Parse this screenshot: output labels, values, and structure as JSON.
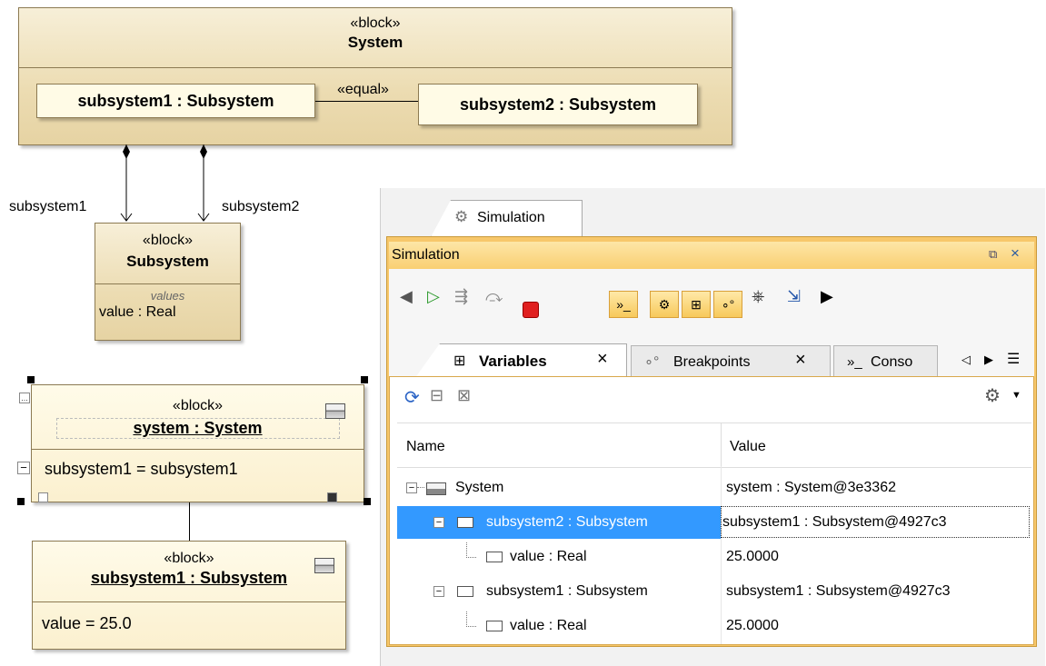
{
  "diagram": {
    "system_block": {
      "stereotype": "«block»",
      "name": "System"
    },
    "parts": {
      "sub1": "subsystem1 : Subsystem",
      "sub2": "subsystem2 : Subsystem",
      "equal": "«equal»"
    },
    "roles": {
      "r1": "subsystem1",
      "r2": "subsystem2"
    },
    "subsystem_block": {
      "stereotype": "«block»",
      "name": "Subsystem",
      "compartment": "values",
      "value": "value : Real"
    },
    "instance_system": {
      "stereotype": "«block»",
      "name": "system : System",
      "slot": "subsystem1 = subsystem1"
    },
    "instance_sub": {
      "stereotype": "«block»",
      "name": "subsystem1 : Subsystem",
      "slot": "value = 25.0"
    }
  },
  "sim": {
    "outer_tab": "Simulation",
    "title": "Simulation",
    "tabs": {
      "variables": "Variables",
      "breakpoints": "Breakpoints",
      "console": "Conso"
    },
    "columns": {
      "name": "Name",
      "value": "Value"
    },
    "rows": [
      {
        "name": "System",
        "value": "system : System@3e3362"
      },
      {
        "name": "subsystem2 : Subsystem",
        "value": "subsystem1 : Subsystem@4927c3"
      },
      {
        "name": "value : Real",
        "value": "25.0000"
      },
      {
        "name": "subsystem1 : Subsystem",
        "value": "subsystem1 : Subsystem@4927c3"
      },
      {
        "name": "value : Real",
        "value": "25.0000"
      }
    ]
  },
  "colors": {
    "selection": "#3399ff",
    "frame": "#f7c76a",
    "block": "#ecdcb2"
  }
}
